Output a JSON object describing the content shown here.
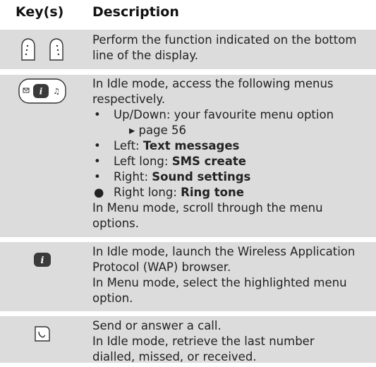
{
  "header": {
    "keys": "Key(s)",
    "description": "Description"
  },
  "rows": [
    {
      "icon": "soft-keys-icon",
      "lines": [
        "Perform the function indicated on the bottom",
        "line of the display."
      ]
    },
    {
      "icon": "navigation-keys-icon",
      "intro": [
        "In Idle mode, access the following menus",
        "respectively."
      ],
      "bullets": [
        {
          "bullet": "•",
          "plain": "Up/Down: your favourite menu option"
        },
        {
          "bullet": "•",
          "plain": "Left: ",
          "bold": "Text messages"
        },
        {
          "bullet": "•",
          "plain": "Left long: ",
          "bold": "SMS create"
        },
        {
          "bullet": "•",
          "plain": "Right: ",
          "bold": "Sound settings"
        },
        {
          "bullet": "●",
          "plain": "Right long: ",
          "bold": "Ring tone"
        }
      ],
      "page_ref": "▸ page 56",
      "outro": [
        "In Menu mode, scroll through the menu",
        "options."
      ]
    },
    {
      "icon": "wap-key-icon",
      "lines": [
        "In Idle mode, launch the Wireless Application",
        "Protocol (WAP) browser.",
        "In Menu mode, select the highlighted menu",
        "option."
      ]
    },
    {
      "icon": "send-key-icon",
      "lines": [
        "Send or answer a call.",
        "In Idle mode, retrieve the last number",
        "dialled, missed, or received."
      ]
    }
  ]
}
